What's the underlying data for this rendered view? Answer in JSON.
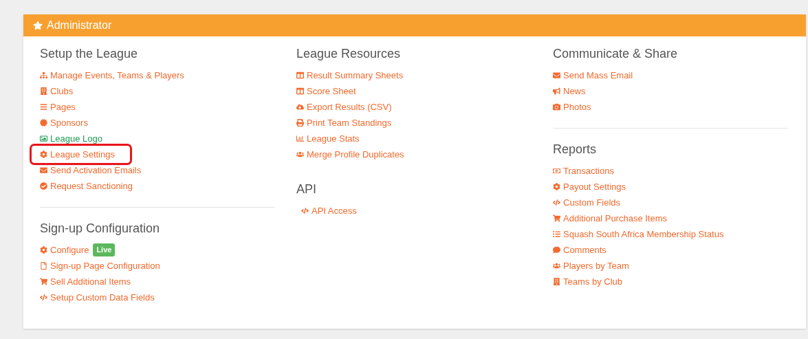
{
  "panel": {
    "title": "Administrator"
  },
  "columns": [
    {
      "sections": [
        {
          "heading": "Setup the League",
          "divider": false,
          "links": [
            {
              "label": "Manage Events, Teams & Players",
              "visited": false,
              "annotated": false
            },
            {
              "label": "Clubs",
              "visited": false,
              "annotated": false
            },
            {
              "label": "Pages",
              "visited": false,
              "annotated": false
            },
            {
              "label": "Sponsors",
              "visited": false,
              "annotated": false
            },
            {
              "label": "League Logo",
              "visited": true,
              "annotated": false
            },
            {
              "label": "League Settings",
              "visited": false,
              "annotated": true
            },
            {
              "label": "Send Activation Emails",
              "visited": false,
              "annotated": false
            },
            {
              "label": "Request Sanctioning",
              "visited": false,
              "annotated": false
            }
          ]
        },
        {
          "heading": "Sign-up Configuration",
          "divider": true,
          "links": [
            {
              "label": "Configure",
              "badge": "Live",
              "visited": false,
              "annotated": false
            },
            {
              "label": "Sign-up Page Configuration",
              "visited": false,
              "annotated": false
            },
            {
              "label": "Sell Additional Items",
              "visited": false,
              "annotated": false
            },
            {
              "label": "Setup Custom Data Fields",
              "visited": false,
              "annotated": false
            }
          ]
        }
      ]
    },
    {
      "sections": [
        {
          "heading": "League Resources",
          "divider": false,
          "links": [
            {
              "label": "Result Summary Sheets",
              "visited": false,
              "annotated": false
            },
            {
              "label": "Score Sheet",
              "visited": false,
              "annotated": false
            },
            {
              "label": "Export Results (CSV)",
              "visited": false,
              "annotated": false
            },
            {
              "label": "Print Team Standings",
              "visited": false,
              "annotated": false
            },
            {
              "label": "League Stats",
              "visited": false,
              "annotated": false
            },
            {
              "label": "Merge Profile Duplicates",
              "visited": false,
              "annotated": false
            }
          ]
        },
        {
          "heading": "API",
          "divider": false,
          "links": [
            {
              "label": "API Access",
              "visited": false,
              "annotated": false
            }
          ]
        }
      ]
    },
    {
      "sections": [
        {
          "heading": "Communicate & Share",
          "divider": false,
          "links": [
            {
              "label": "Send Mass Email",
              "visited": false,
              "annotated": false
            },
            {
              "label": "News",
              "visited": false,
              "annotated": false
            },
            {
              "label": "Photos",
              "visited": false,
              "annotated": false
            }
          ]
        },
        {
          "heading": "Reports",
          "divider": true,
          "links": [
            {
              "label": "Transactions",
              "visited": false,
              "annotated": false
            },
            {
              "label": "Payout Settings",
              "visited": false,
              "annotated": false
            },
            {
              "label": "Custom Fields",
              "visited": false,
              "annotated": false
            },
            {
              "label": "Additional Purchase Items",
              "visited": false,
              "annotated": false
            },
            {
              "label": "Squash South Africa Membership Status",
              "visited": false,
              "annotated": false
            },
            {
              "label": "Comments",
              "visited": false,
              "annotated": false
            },
            {
              "label": "Players by Team",
              "visited": false,
              "annotated": false
            },
            {
              "label": "Teams by Club",
              "visited": false,
              "annotated": false
            }
          ]
        }
      ]
    }
  ]
}
